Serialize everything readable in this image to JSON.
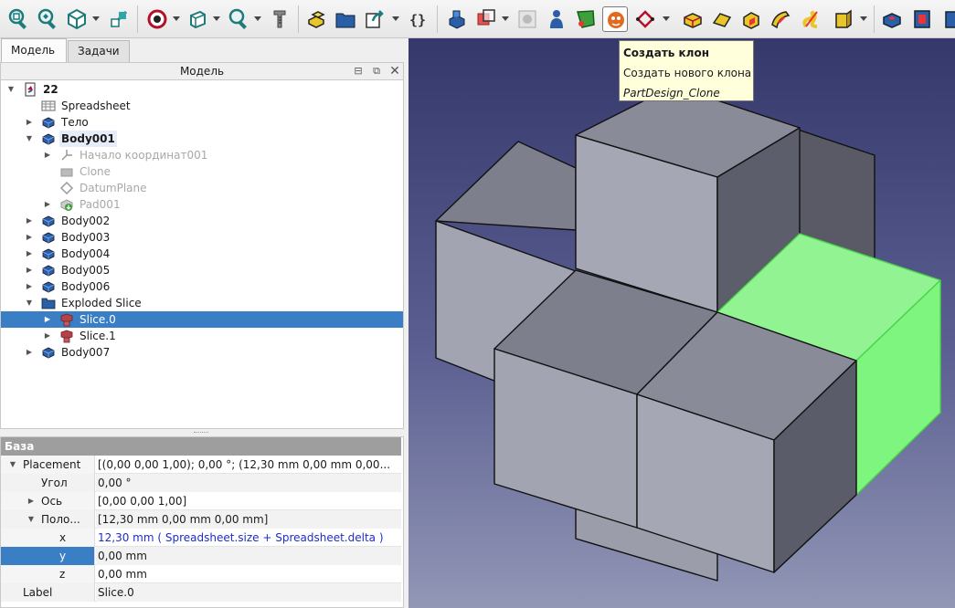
{
  "tabs": [
    "Модель",
    "Задачи"
  ],
  "tree_panel": {
    "title": "Модель"
  },
  "tree": [
    {
      "label": "22",
      "icon": "document-icon",
      "depth": 0,
      "arrow": "down",
      "bold": true
    },
    {
      "label": "Spreadsheet",
      "icon": "spreadsheet-icon",
      "depth": 1,
      "arrow": ""
    },
    {
      "label": "Тело",
      "icon": "body-icon",
      "depth": 1,
      "arrow": "right"
    },
    {
      "label": "Body001",
      "icon": "body-icon",
      "depth": 1,
      "arrow": "down",
      "bold": true,
      "highlight": true
    },
    {
      "label": "Начало координат001",
      "icon": "origin-icon",
      "depth": 2,
      "arrow": "right",
      "dim": true
    },
    {
      "label": "Clone",
      "icon": "clone-icon",
      "depth": 2,
      "arrow": "",
      "dim": true
    },
    {
      "label": "DatumPlane",
      "icon": "datum-plane-icon",
      "depth": 2,
      "arrow": "",
      "dim": true
    },
    {
      "label": "Pad001",
      "icon": "pad-icon",
      "depth": 2,
      "arrow": "right",
      "dim": true
    },
    {
      "label": "Body002",
      "icon": "body-icon",
      "depth": 1,
      "arrow": "right"
    },
    {
      "label": "Body003",
      "icon": "body-icon",
      "depth": 1,
      "arrow": "right"
    },
    {
      "label": "Body004",
      "icon": "body-icon",
      "depth": 1,
      "arrow": "right"
    },
    {
      "label": "Body005",
      "icon": "body-icon",
      "depth": 1,
      "arrow": "right"
    },
    {
      "label": "Body006",
      "icon": "body-icon",
      "depth": 1,
      "arrow": "right"
    },
    {
      "label": "Exploded Slice",
      "icon": "folder-icon",
      "depth": 1,
      "arrow": "down"
    },
    {
      "label": "Slice.0",
      "icon": "slice-icon",
      "depth": 2,
      "arrow": "right",
      "selected": true
    },
    {
      "label": "Slice.1",
      "icon": "slice-icon",
      "depth": 2,
      "arrow": "right"
    },
    {
      "label": "Body007",
      "icon": "body-icon",
      "depth": 1,
      "arrow": "right"
    }
  ],
  "properties": {
    "group": "База",
    "rows": [
      {
        "name": "Placement",
        "value": "[(0,00 0,00 1,00); 0,00 °; (12,30 mm  0,00 mm  0,00...",
        "depth": 0,
        "arrow": "down"
      },
      {
        "name": "Угол",
        "value": "0,00 °",
        "depth": 1,
        "arrow": ""
      },
      {
        "name": "Ось",
        "value": "[0,00 0,00 1,00]",
        "depth": 1,
        "arrow": "right"
      },
      {
        "name": "Поло...",
        "value": "[12,30 mm  0,00 mm  0,00 mm]",
        "depth": 1,
        "arrow": "down"
      },
      {
        "name": "x",
        "value": "12,30 mm  ( Spreadsheet.size + Spreadsheet.delta )",
        "depth": 2,
        "arrow": "",
        "expression": true
      },
      {
        "name": "y",
        "value": "0,00 mm",
        "depth": 2,
        "arrow": "",
        "selected": true
      },
      {
        "name": "z",
        "value": "0,00 mm",
        "depth": 2,
        "arrow": ""
      },
      {
        "name": "Label",
        "value": "Slice.0",
        "depth": 0,
        "arrow": ""
      }
    ]
  },
  "tooltip": {
    "title": "Создать клон",
    "description": "Создать нового клона",
    "command": "PartDesign_Clone"
  },
  "toolbar_icons": [
    "zoom-fit-all-icon",
    "zoom-fit-selection-icon",
    "view-cube-icon",
    "view-axo-icon",
    "draw-style-icon",
    "bounding-box-icon",
    "zoom-icon",
    "measure-icon",
    "part-design-body-icon",
    "part-icon",
    "link-icon",
    "variable-set-icon",
    "shape-binder-icon",
    "sub-shape-binder-icon",
    "check-geometry-icon",
    "clone-icon",
    "datum-icon",
    "sketch-icon",
    "pad-icon",
    "revolution-icon",
    "loft-icon",
    "pipe-icon",
    "helix-icon",
    "additive-box-icon",
    "pocket-icon",
    "hole-icon"
  ],
  "colors": {
    "selection": "#3a7fc6",
    "tooltip_bg": "#ffffdc",
    "highlight_face": "#8cff8c"
  }
}
